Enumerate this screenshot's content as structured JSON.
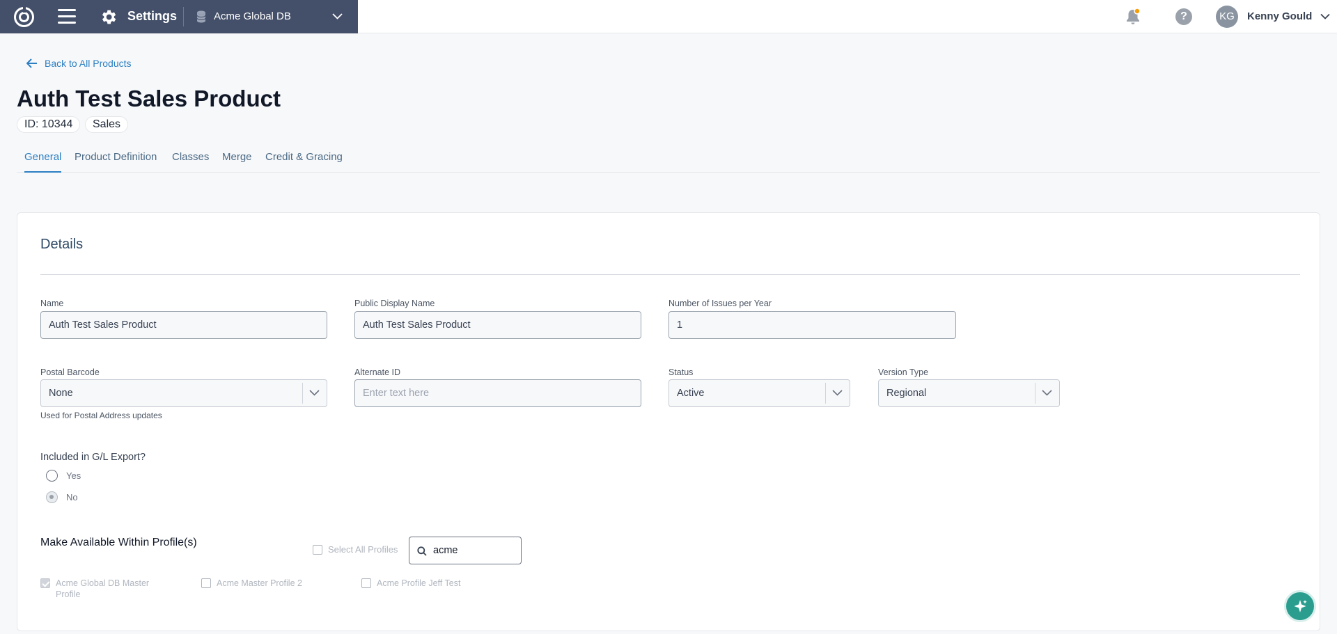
{
  "header": {
    "app_title": "Settings",
    "database": "Acme Global DB",
    "user_initials": "KG",
    "user_name": "Kenny Gould",
    "help_glyph": "?",
    "brand_color": "#445069",
    "notification_dot_color": "#f59e0b"
  },
  "back_link": "Back to All Products",
  "product": {
    "title": "Auth Test Sales Product",
    "id_label": "ID: 10344",
    "type": "Sales"
  },
  "tabs": [
    {
      "label": "General",
      "active": true
    },
    {
      "label": "Product Definition",
      "active": false
    },
    {
      "label": "Classes",
      "active": false
    },
    {
      "label": "Merge",
      "active": false
    },
    {
      "label": "Credit & Gracing",
      "active": false
    }
  ],
  "details": {
    "title": "Details",
    "name": {
      "label": "Name",
      "value": "Auth Test Sales Product"
    },
    "public_display_name": {
      "label": "Public Display Name",
      "value": "Auth Test Sales Product"
    },
    "issues_per_year": {
      "label": "Number of Issues per Year",
      "value": "1"
    },
    "postal_barcode": {
      "label": "Postal Barcode",
      "value": "None",
      "help": "Used for Postal Address updates"
    },
    "alternate_id": {
      "label": "Alternate ID",
      "placeholder": "Enter text here"
    },
    "status": {
      "label": "Status",
      "value": "Active"
    },
    "version_type": {
      "label": "Version Type",
      "value": "Regional"
    },
    "gl_export": {
      "question": "Included in G/L Export?",
      "options": [
        {
          "label": "Yes",
          "checked": false
        },
        {
          "label": "No",
          "checked": true
        }
      ]
    },
    "profiles": {
      "title": "Make Available Within Profile(s)",
      "select_all_label": "Select All Profiles",
      "search_value": "acme",
      "items": [
        {
          "label_line1": "Acme Global DB Master",
          "label_line2": "Profile",
          "checked": true
        },
        {
          "label_line1": "Acme Master Profile 2",
          "label_line2": "",
          "checked": false
        },
        {
          "label_line1": "Acme Profile Jeff Test",
          "label_line2": "",
          "checked": false
        }
      ]
    }
  }
}
